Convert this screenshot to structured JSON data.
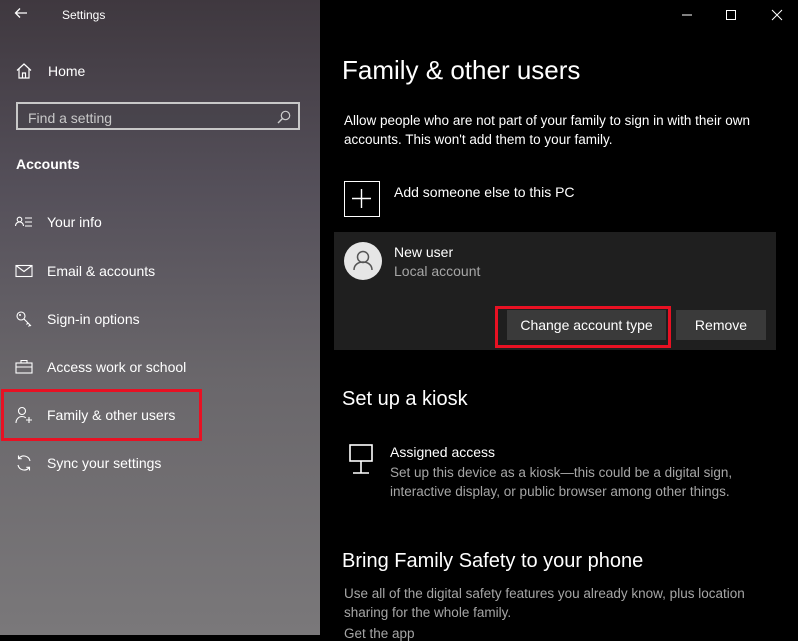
{
  "window": {
    "title": "Settings",
    "back_icon": "back-arrow-icon",
    "controls": [
      "minimize-icon",
      "maximize-icon",
      "close-icon"
    ]
  },
  "sidebar": {
    "home_label": "Home",
    "search_placeholder": "Find a setting",
    "section_title": "Accounts",
    "items": [
      {
        "label": "Your info",
        "icon": "person-card-icon"
      },
      {
        "label": "Email & accounts",
        "icon": "mail-icon"
      },
      {
        "label": "Sign-in options",
        "icon": "key-icon"
      },
      {
        "label": "Access work or school",
        "icon": "briefcase-icon"
      },
      {
        "label": "Family & other users",
        "icon": "add-person-icon",
        "selected": true
      },
      {
        "label": "Sync your settings",
        "icon": "sync-icon"
      }
    ]
  },
  "main": {
    "title": "Family & other users",
    "description": "Allow people who are not part of your family to sign in with their own accounts. This won't add them to your family.",
    "add_label": "Add someone else to this PC",
    "user": {
      "name": "New user",
      "type": "Local account",
      "change_button": "Change account type",
      "remove_button": "Remove"
    },
    "kiosk": {
      "heading": "Set up a kiosk",
      "title": "Assigned access",
      "description": "Set up this device as a kiosk—this could be a digital sign, interactive display, or public browser among other things."
    },
    "family": {
      "heading": "Bring Family Safety to your phone",
      "description": "Use all of the digital safety features you already know, plus location sharing for the whole family.",
      "link": "Get the app"
    }
  },
  "colors": {
    "highlight": "#e81123",
    "panel": "#1f1f1f",
    "button": "#3a3a3a",
    "secondary_text": "#a6a6a6"
  }
}
